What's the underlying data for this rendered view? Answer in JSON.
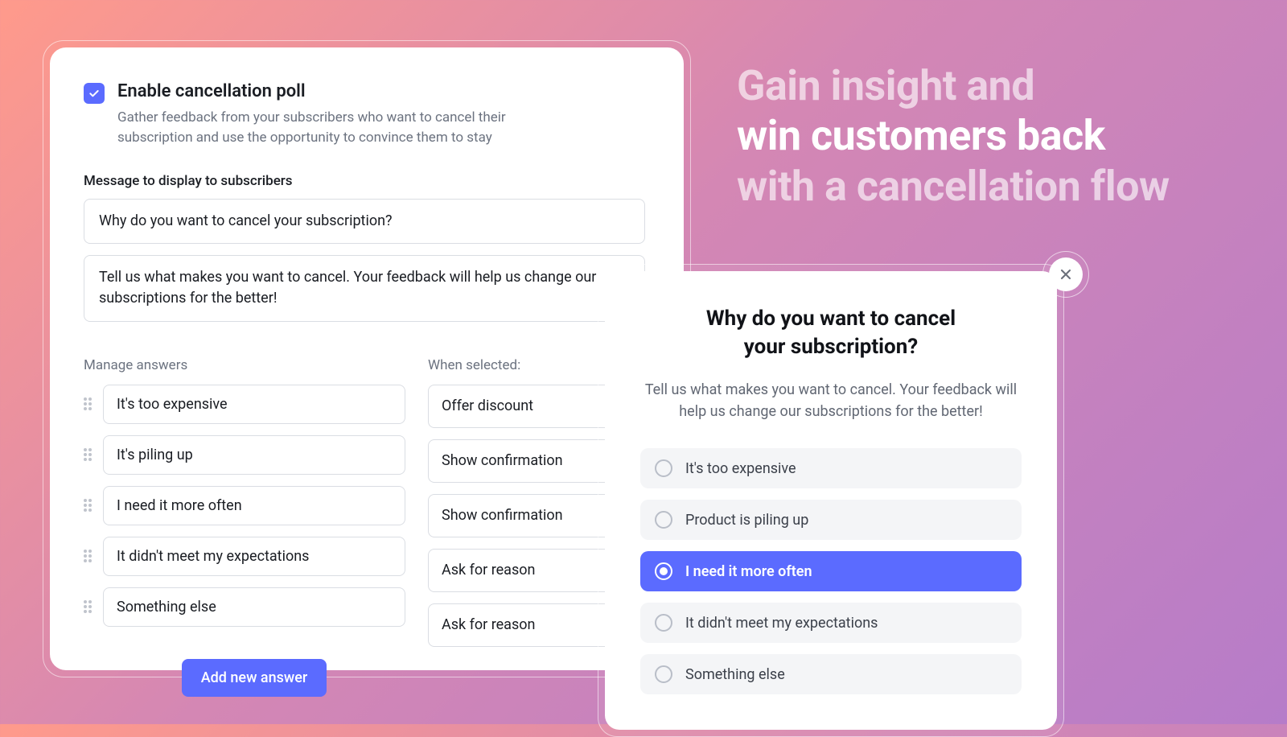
{
  "admin": {
    "enable_label": "Enable cancellation poll",
    "enable_desc": "Gather feedback from your subscribers who want to cancel their subscription and use the opportunity to convince them to stay",
    "message_section_label": "Message to display to subscribers",
    "question_text": "Why do you want to cancel your subscription?",
    "description_text": "Tell us what makes you want to cancel. Your feedback will help us change our  subscriptions for the better!",
    "manage_answers_label": "Manage answers",
    "when_selected_label": "When selected:",
    "answers": [
      {
        "text": "It's too expensive",
        "action": "Offer discount"
      },
      {
        "text": "It's piling up",
        "action": "Show confirmation"
      },
      {
        "text": "I need it more often",
        "action": "Show confirmation"
      },
      {
        "text": "It didn't meet my expectations",
        "action": "Ask for reason"
      },
      {
        "text": "Something else",
        "action": "Ask for reason"
      }
    ],
    "add_answer_label": "Add new answer"
  },
  "headline": {
    "line1": "Gain insight and",
    "line2": "win customers back",
    "line3": "with a cancellation flow"
  },
  "preview": {
    "title_line1": "Why do you want to cancel",
    "title_line2": "your subscription?",
    "desc": "Tell us what makes you want to cancel. Your feedback will help us change our subscriptions for the better!",
    "options": [
      {
        "label": "It's too expensive",
        "selected": false
      },
      {
        "label": "Product is piling up",
        "selected": false
      },
      {
        "label": "I need it more often",
        "selected": true
      },
      {
        "label": "It didn't meet my expectations",
        "selected": false
      },
      {
        "label": "Something else",
        "selected": false
      }
    ]
  }
}
